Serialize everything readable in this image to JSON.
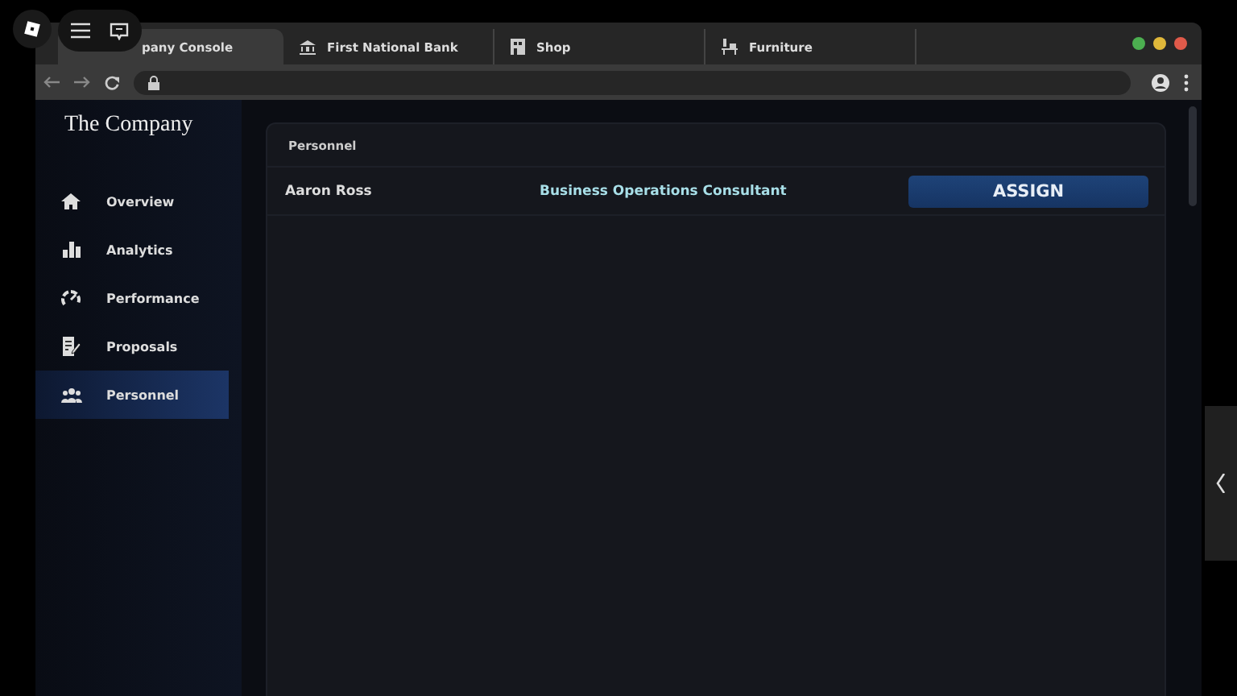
{
  "tabs": [
    {
      "label": "pany Console",
      "selected": true
    },
    {
      "label": "First National Bank",
      "selected": false
    },
    {
      "label": "Shop",
      "selected": false
    },
    {
      "label": "Furniture",
      "selected": false
    }
  ],
  "sidebar": {
    "title": "The Company",
    "items": [
      {
        "label": "Overview",
        "selected": false
      },
      {
        "label": "Analytics",
        "selected": false
      },
      {
        "label": "Performance",
        "selected": false
      },
      {
        "label": "Proposals",
        "selected": false
      },
      {
        "label": "Personnel",
        "selected": true
      }
    ]
  },
  "panel": {
    "title": "Personnel",
    "rows": [
      {
        "name": "Aaron Ross",
        "role": "Business Operations Consultant",
        "action": "ASSIGN"
      }
    ]
  }
}
